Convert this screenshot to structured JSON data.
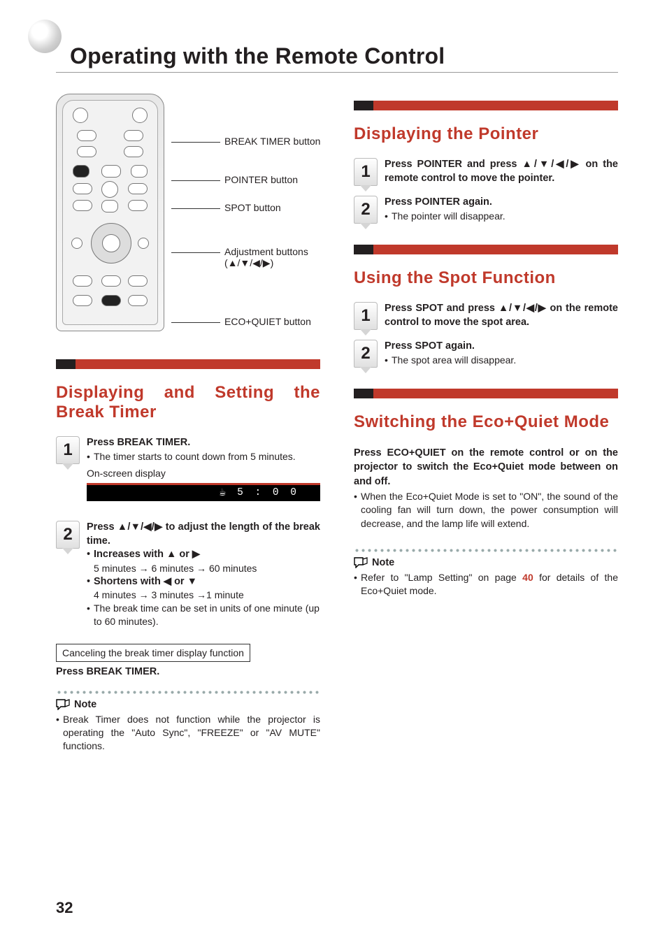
{
  "pageNumber": "32",
  "title": "Operating with the Remote Control",
  "remoteLabels": {
    "breakTimer": "BREAK TIMER button",
    "pointer": "POINTER button",
    "spot": "SPOT button",
    "adjustment": "Adjustment buttons",
    "adjustmentArrows": "(▲/▼/◀/▶)",
    "ecoQuiet": "ECO+QUIET button"
  },
  "left": {
    "heading": "Displaying and Setting the Break Timer",
    "step1_main_a": "Press ",
    "step1_main_b": "BREAK TIMER",
    "step1_main_c": ".",
    "step1_sub": "The timer starts to count down from 5 minutes.",
    "osdLabel": "On-screen display",
    "osdTime": "5 : 0 0",
    "step2_main": "Press ▲/▼/◀/▶ to adjust the length of the break time.",
    "step2_inc_label": "Increases with ▲ or ▶",
    "step2_inc_detail": "5 minutes → 6 minutes → 60 minutes",
    "step2_dec_label": "Shortens with ◀ or ▼",
    "step2_dec_detail": "4 minutes → 3 minutes →1 minute",
    "step2_note": "The break time can be set in units of one minute (up to 60 minutes).",
    "cancelBox": "Canceling the break timer display function",
    "cancelPress_a": "Press ",
    "cancelPress_b": "BREAK TIMER",
    "cancelPress_c": ".",
    "noteLabel": "Note",
    "noteText": "Break Timer does not function while the projector is operating the \"Auto Sync\", \"FREEZE\" or \"AV MUTE\" functions."
  },
  "right": {
    "pointerHeading": "Displaying the Pointer",
    "pointer_step1_a": "Press ",
    "pointer_step1_b": "POINTER",
    "pointer_step1_c": " and press ▲/▼/◀/▶ on the remote control to move the pointer.",
    "pointer_step2_a": "Press ",
    "pointer_step2_b": "POINTER",
    "pointer_step2_c": " again.",
    "pointer_step2_sub": "The pointer will disappear.",
    "spotHeading": "Using the Spot Function",
    "spot_step1_a": "Press ",
    "spot_step1_b": "SPOT",
    "spot_step1_c": " and press ▲/▼/◀/▶ on the remote control to move the spot area.",
    "spot_step2_a": "Press ",
    "spot_step2_b": "SPOT",
    "spot_step2_c": " again.",
    "spot_step2_sub": "The spot area will disappear.",
    "ecoHeading": "Switching the Eco+Quiet Mode",
    "eco_main_a": "Press ",
    "eco_main_b": "ECO+QUIET",
    "eco_main_c": " on the remote control or on the projector to switch the Eco+Quiet mode between on and off.",
    "eco_sub": "When the Eco+Quiet Mode is set to \"ON\", the sound of the cooling fan will turn down, the power consumption will decrease, and the lamp life will extend.",
    "noteLabel": "Note",
    "eco_note_a": "Refer to \"Lamp Setting\" on page ",
    "eco_note_page": "40",
    "eco_note_b": " for details of the Eco+Quiet mode."
  }
}
